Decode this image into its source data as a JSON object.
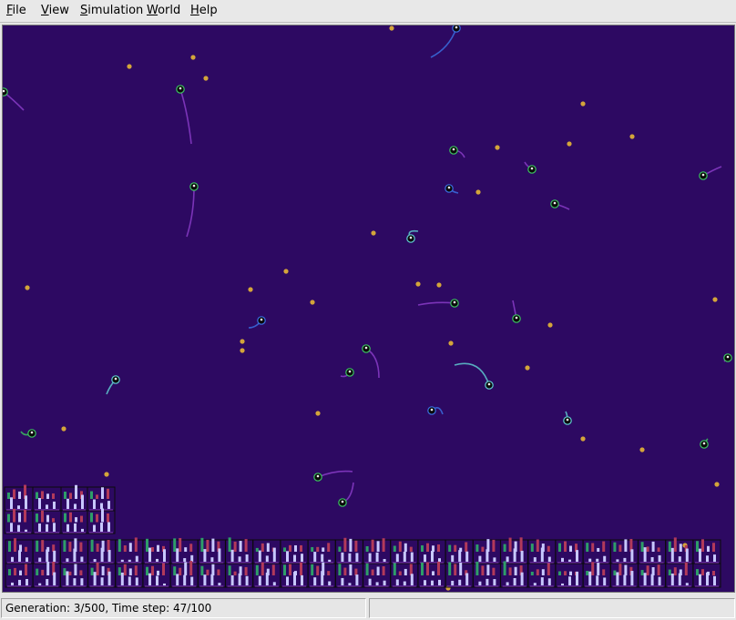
{
  "menubar": {
    "items": [
      {
        "label": "F",
        "rest": "ile"
      },
      {
        "label": "V",
        "rest": "iew"
      },
      {
        "label": "S",
        "rest": "imulation"
      },
      {
        "label": "W",
        "rest": "orld"
      },
      {
        "label": "H",
        "rest": "elp"
      }
    ]
  },
  "simulation": {
    "background_color": "#2d0962",
    "food_color": "#d4a53a",
    "agent_body_color": "#0a0a0a",
    "trail_colors": [
      "#8a3cc8",
      "#3a6ee0",
      "#5fc9d0",
      "#3cc060"
    ],
    "panel_bar_colors": [
      "#2e9e68",
      "#b23a5a",
      "#c8c8ff",
      "#8a3cc8"
    ]
  },
  "status": {
    "text": "Generation: 3/500, Time step: 47/100",
    "right_text": ""
  }
}
